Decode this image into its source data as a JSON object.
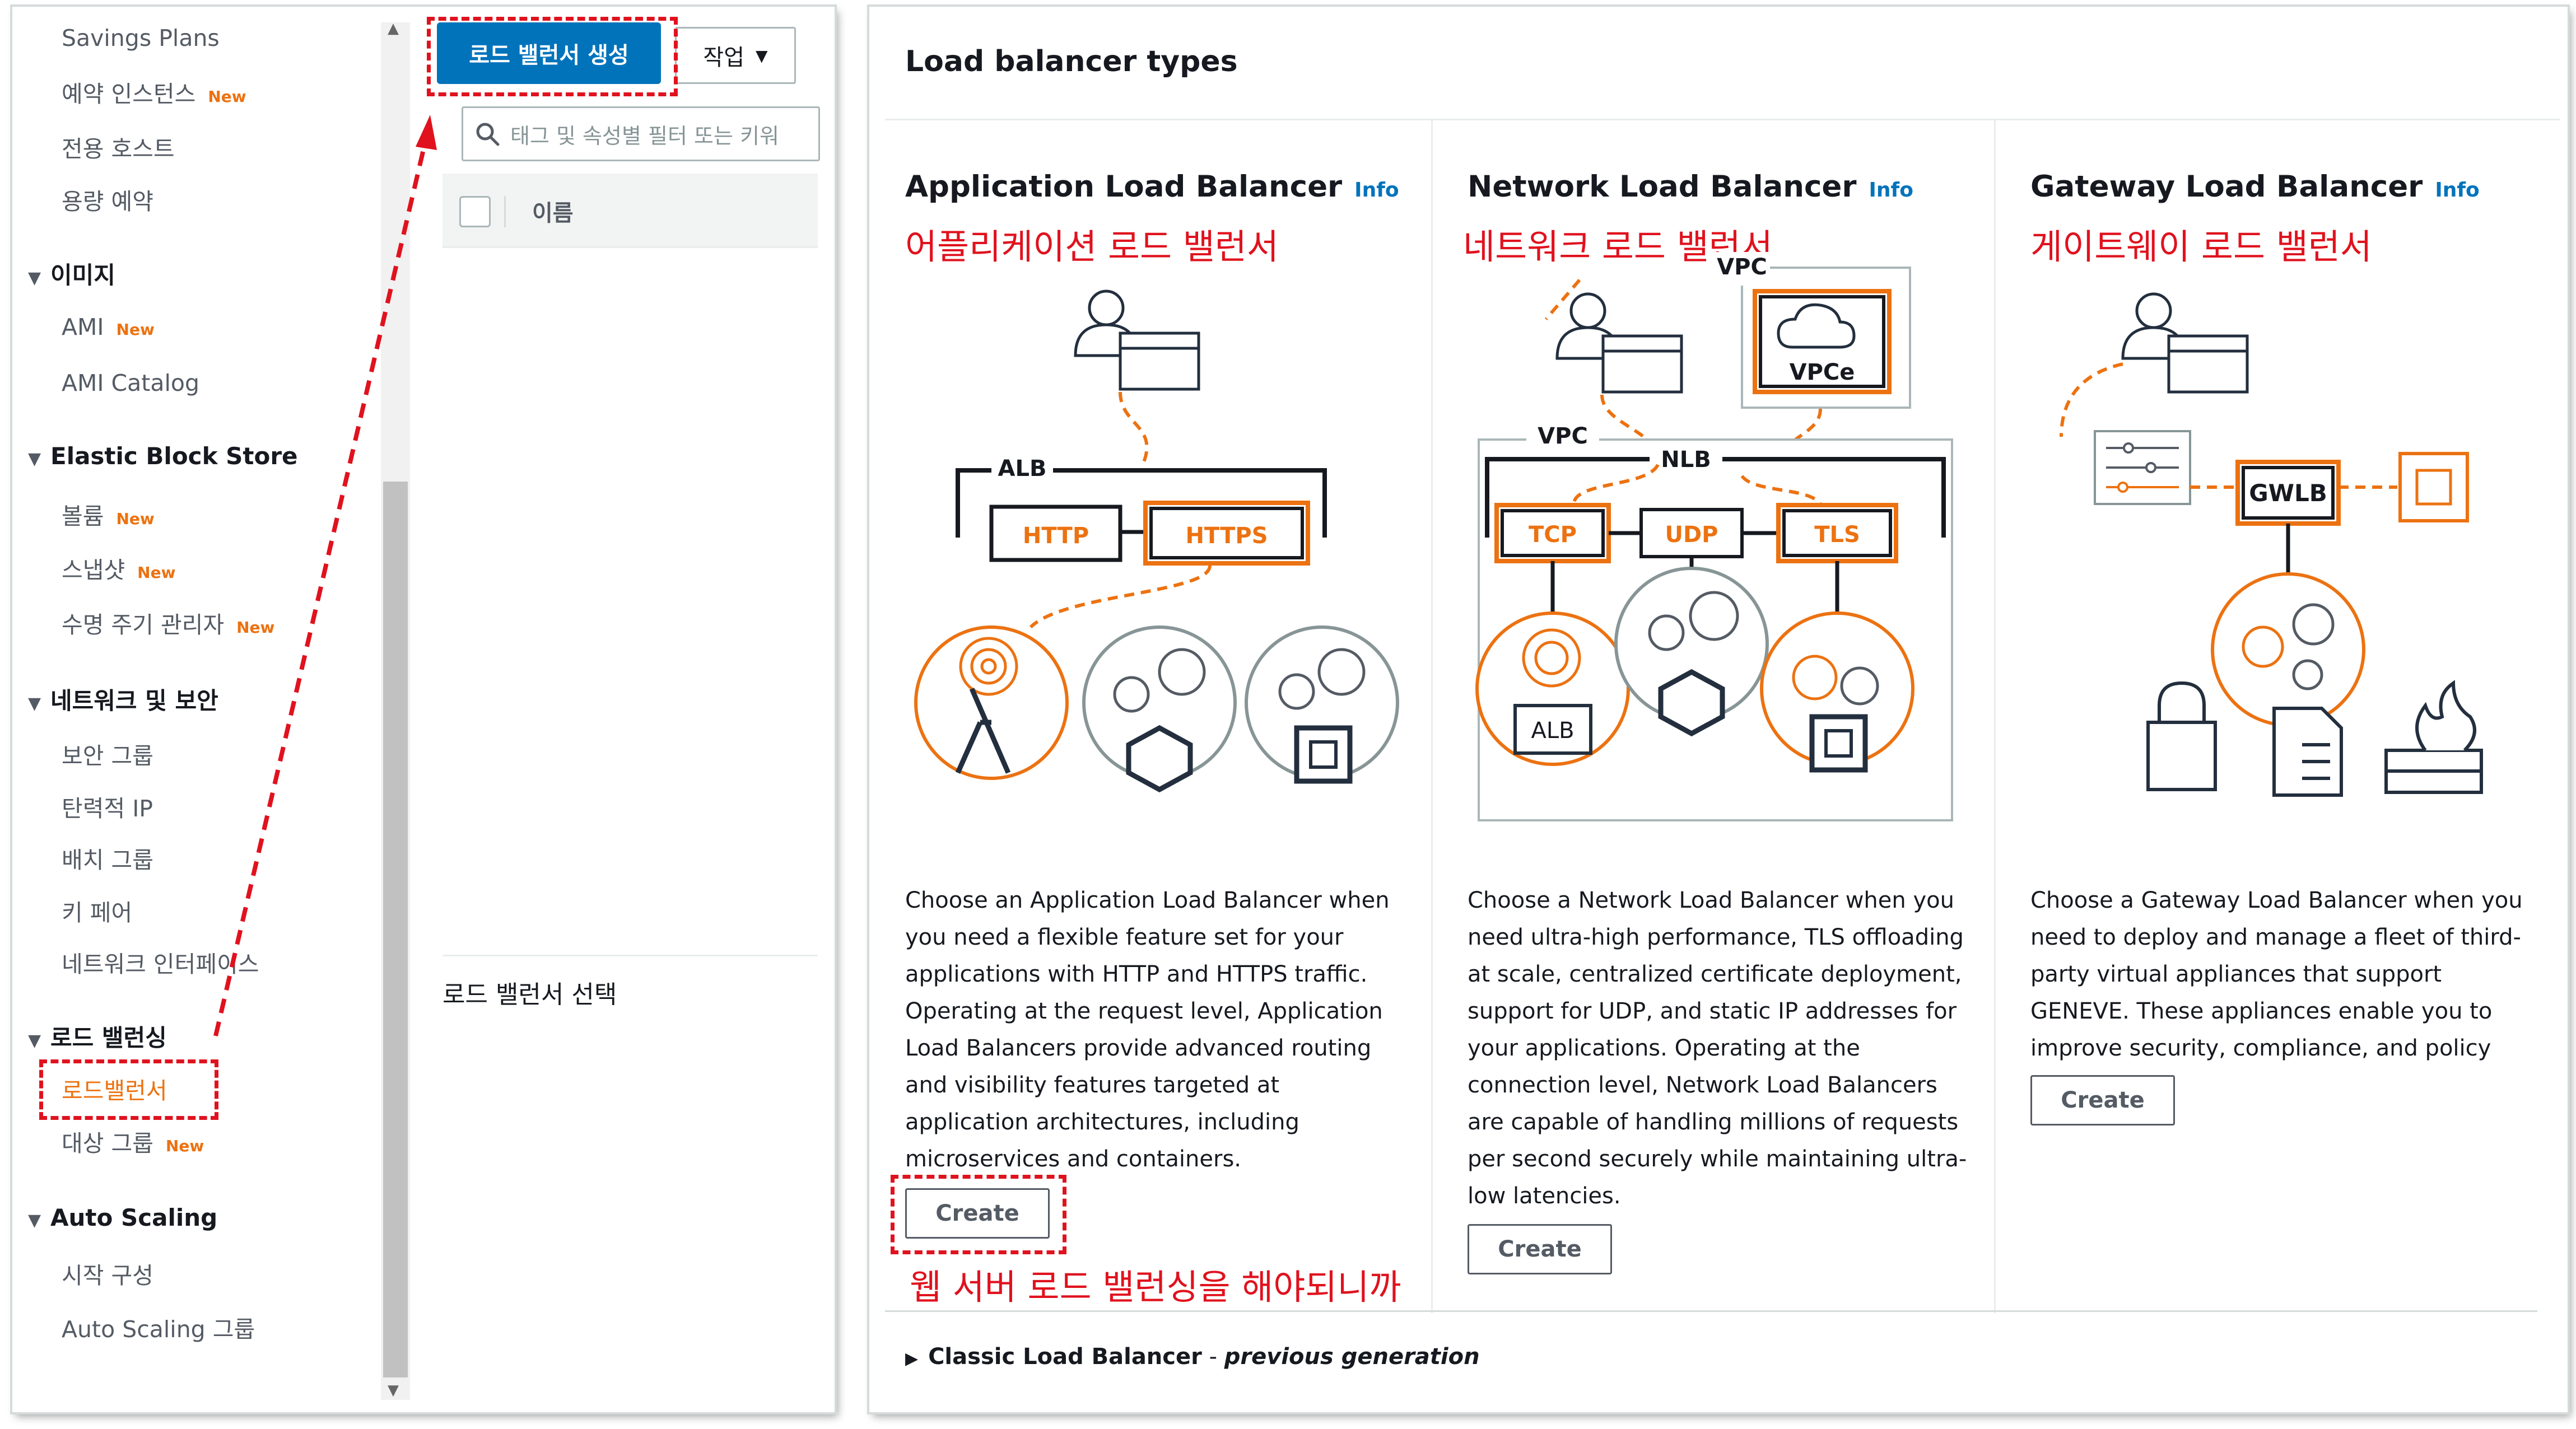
{
  "sidebar": {
    "items": [
      {
        "label": "Savings Plans"
      },
      {
        "label": "예약 인스턴스",
        "badge": "New"
      },
      {
        "label": "전용 호스트"
      },
      {
        "label": "용량 예약"
      },
      {
        "section": "이미지"
      },
      {
        "label": "AMI",
        "badge": "New"
      },
      {
        "label": "AMI Catalog"
      },
      {
        "section": "Elastic Block Store"
      },
      {
        "label": "볼륨",
        "badge": "New"
      },
      {
        "label": "스냅샷",
        "badge": "New"
      },
      {
        "label": "수명 주기 관리자",
        "badge": "New"
      },
      {
        "section": "네트워크 및 보안"
      },
      {
        "label": "보안 그룹"
      },
      {
        "label": "탄력적 IP"
      },
      {
        "label": "배치 그룹"
      },
      {
        "label": "키 페어"
      },
      {
        "label": "네트워크 인터페이스"
      },
      {
        "section": "로드 밸런싱"
      },
      {
        "label": "로드밸런서",
        "active": true
      },
      {
        "label": "대상 그룹",
        "badge": "New"
      },
      {
        "section": "Auto Scaling"
      },
      {
        "label": "시작 구성"
      },
      {
        "label": "Auto Scaling 그룹"
      }
    ]
  },
  "toolbar": {
    "create_label": "로드 밸런서 생성",
    "actions_label": "작업",
    "search_placeholder": "태그 및 속성별 필터 또는 키워",
    "column_name": "이름",
    "select_prompt": "로드 밸런서 선택"
  },
  "types": {
    "title": "Load balancer types",
    "info_label": "Info",
    "cards": [
      {
        "title": "Application Load Balancer",
        "annotation": "어플리케이션 로드 밸런서",
        "diagram_labels": {
          "alb": "ALB",
          "http": "HTTP",
          "https": "HTTPS"
        },
        "description": "Choose an Application Load Balancer when you need a flexible feature set for your applications with HTTP and HTTPS traffic. Operating at the request level, Application Load Balancers provide advanced routing and visibility features targeted at application architectures, including microservices and containers.",
        "create_label": "Create"
      },
      {
        "title": "Network Load Balancer",
        "annotation": "네트워크 로드 밸런서",
        "diagram_labels": {
          "vpc_top": "VPC",
          "vpce": "VPCe",
          "vpc": "VPC",
          "nlb": "NLB",
          "tcp": "TCP",
          "udp": "UDP",
          "tls": "TLS",
          "alb": "ALB"
        },
        "description": "Choose a Network Load Balancer when you need ultra-high performance, TLS offloading at scale, centralized certificate deployment, support for UDP, and static IP addresses for your applications. Operating at the connection level, Network Load Balancers are capable of handling millions of requests per second securely while maintaining ultra-low latencies.",
        "create_label": "Create"
      },
      {
        "title": "Gateway Load Balancer",
        "annotation": "게이트웨이 로드 밸런서",
        "diagram_labels": {
          "gwlb": "GWLB"
        },
        "description": "Choose a Gateway Load Balancer when you need to deploy and manage a fleet of third-party virtual appliances that support GENEVE. These appliances enable you to improve security, compliance, and policy controls.",
        "create_label": "Create"
      }
    ],
    "classic_label": "Classic Load Balancer",
    "classic_suffix": "previous generation"
  },
  "annotations": {
    "bottom_note": "웹 서버 로드 밸런싱을 해야되니까"
  },
  "colors": {
    "accent_orange": "#ec7211",
    "primary_blue": "#0073bb",
    "annotation_red": "#e0121e"
  }
}
